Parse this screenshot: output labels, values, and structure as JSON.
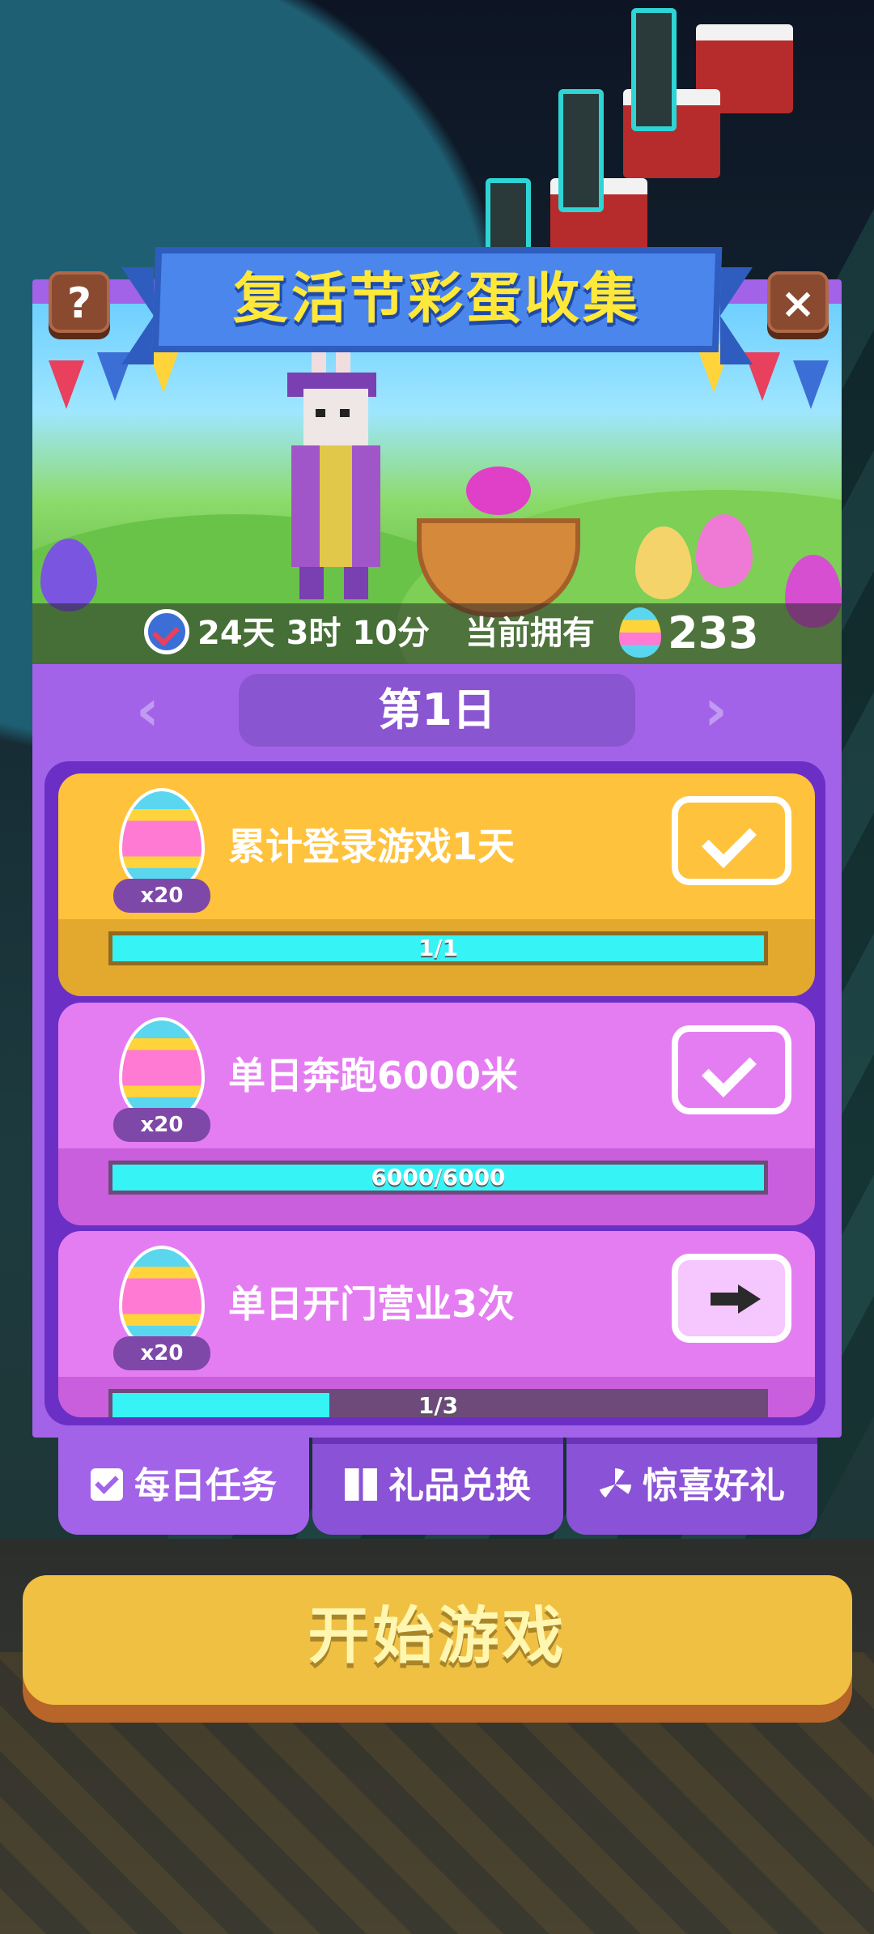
{
  "event": {
    "title": "复活节彩蛋收集",
    "help_label": "?",
    "close_label": "×",
    "countdown": "24天 3时 10分",
    "owned_label": "当前拥有",
    "owned_count": "233"
  },
  "day_selector": {
    "prev": "‹",
    "label": "第1日",
    "next": "›"
  },
  "tasks": [
    {
      "reward": "x20",
      "label": "累计登录游戏1天",
      "progress_text": "1/1",
      "progress": 1.0,
      "status": "completed"
    },
    {
      "reward": "x20",
      "label": "单日奔跑6000米",
      "progress_text": "6000/6000",
      "progress": 1.0,
      "status": "completed"
    },
    {
      "reward": "x20",
      "label": "单日开门营业3次",
      "progress_text": "1/3",
      "progress": 0.333,
      "status": "go"
    }
  ],
  "tabs": [
    {
      "label": "每日任务",
      "icon": "checkbox-icon",
      "active": true
    },
    {
      "label": "礼品兑换",
      "icon": "gift-icon",
      "active": false
    },
    {
      "label": "惊喜好礼",
      "icon": "sparkle-icon",
      "active": false
    }
  ],
  "start_button": "开始游戏",
  "colors": {
    "panel": "#a263e8",
    "task_yellow": "#ffc23c",
    "task_pink": "#e57df2",
    "progress_fill": "#36f3f6",
    "start": "#f0c043",
    "title": "#ffe83a"
  }
}
